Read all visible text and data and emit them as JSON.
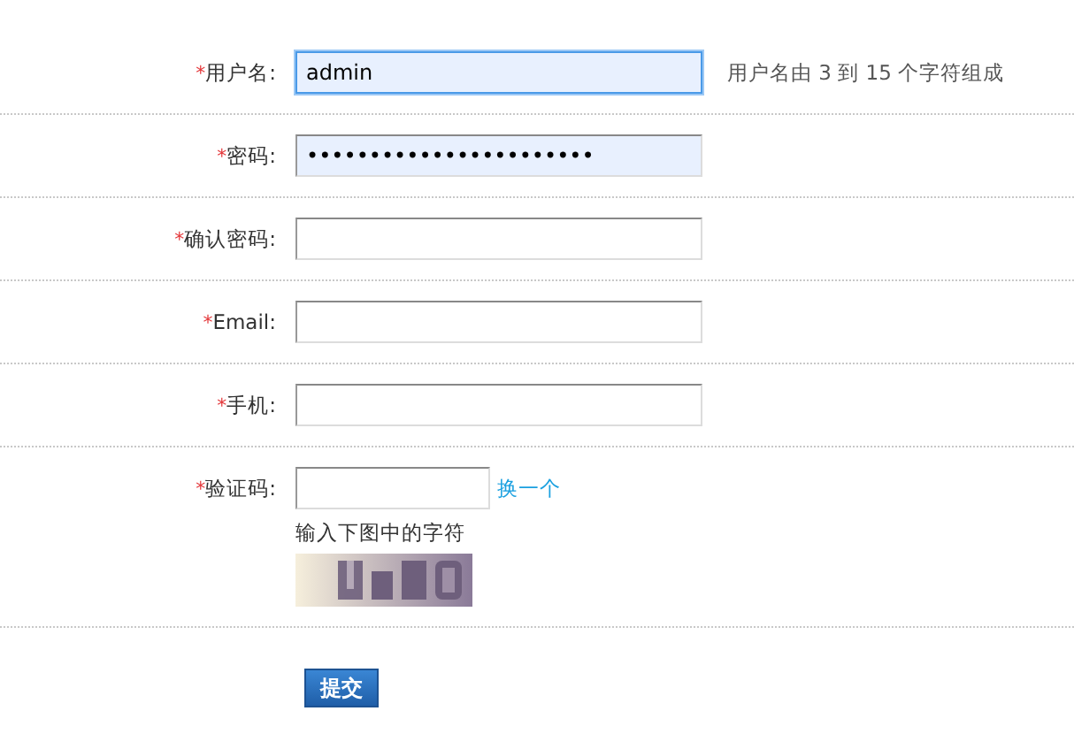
{
  "fields": [
    {
      "kind": "text",
      "mark": "*",
      "label": "用户名:",
      "value": "admin",
      "focused": true,
      "autofilled": true,
      "hint": "用户名由 3 到 15 个字符组成"
    },
    {
      "kind": "text",
      "mark": "*",
      "label": "密码:",
      "value": "•••••••••••••••••••••••",
      "focused": false,
      "autofilled": true
    },
    {
      "kind": "text",
      "mark": "*",
      "label": "确认密码:",
      "focused": false,
      "autofilled": false
    },
    {
      "kind": "text",
      "mark": "*",
      "label": "Email:",
      "focused": false,
      "autofilled": false
    },
    {
      "kind": "text",
      "mark": "*",
      "label": "手机:",
      "focused": false,
      "autofilled": false
    },
    {
      "kind": "captcha",
      "mark": "*",
      "label": "验证码:",
      "focused": false,
      "autofilled": false,
      "link": "换一个",
      "instruction": "输入下图中的字符"
    }
  ],
  "submit": "提交"
}
